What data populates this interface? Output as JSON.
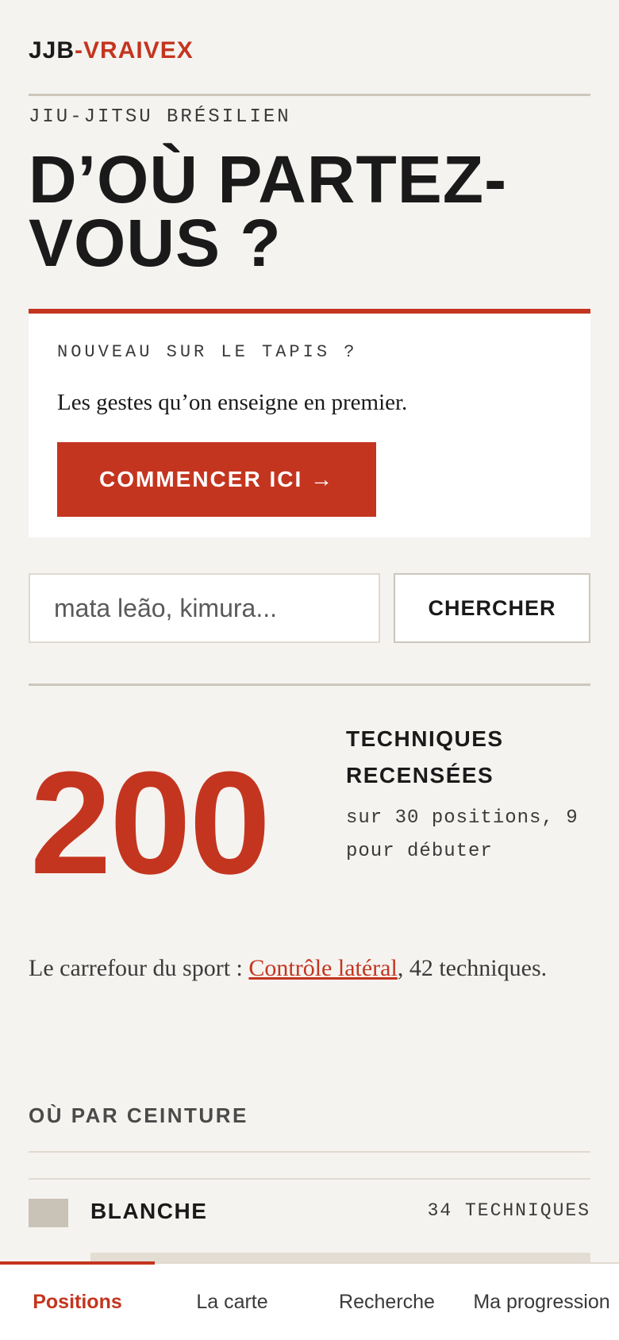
{
  "header": {
    "logo_part1": "JJB",
    "logo_part2": "-VRAIVEX"
  },
  "hero": {
    "eyebrow": "JIU-JITSU BRÉSILIEN",
    "title": "D’OÙ PARTEZ-VOUS ?"
  },
  "beginner_card": {
    "kicker": "NOUVEAU SUR LE TAPIS ?",
    "text": "Les gestes qu’on enseigne en premier.",
    "cta_label": "COMMENCER ICI →"
  },
  "search": {
    "placeholder": "mata leão, kimura...",
    "value": "",
    "button_label": "CHERCHER"
  },
  "stats": {
    "count": "200",
    "label": "TECHNIQUES RECENSÉES",
    "subtitle": "sur 30 positions, 9 pour débuter"
  },
  "carrefour": {
    "prefix": "Le carrefour du sport : ",
    "link_text": "Contrôle latéral",
    "suffix": ", 42 techniques."
  },
  "belts": {
    "heading": "OÙ PAR CEINTURE",
    "items": [
      {
        "name": "BLANCHE",
        "count": "34 TECHNIQUES",
        "color": "#c9c2b6"
      }
    ]
  },
  "bottom_nav": {
    "items": [
      {
        "label": "Positions",
        "active": true
      },
      {
        "label": "La carte",
        "active": false
      },
      {
        "label": "Recherche",
        "active": false
      },
      {
        "label": "Ma progression",
        "active": false
      }
    ]
  },
  "colors": {
    "accent": "#c4351f",
    "background": "#f5f3f0",
    "text": "#1a1a1a"
  }
}
